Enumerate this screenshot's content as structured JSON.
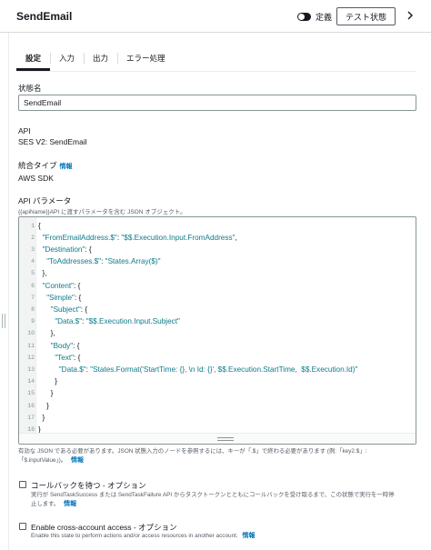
{
  "header": {
    "title": "SendEmail",
    "toggle_label": "定義",
    "test_button": "テスト状態"
  },
  "tabs": [
    {
      "label": "設定",
      "active": true
    },
    {
      "label": "入力",
      "active": false
    },
    {
      "label": "出力",
      "active": false
    },
    {
      "label": "エラー処理",
      "active": false
    }
  ],
  "state_name": {
    "label": "状態名",
    "value": "SendEmail"
  },
  "api": {
    "label": "API",
    "value": "SES V2: SendEmail"
  },
  "integration": {
    "label": "統合タイプ",
    "info": "情報",
    "value": "AWS SDK"
  },
  "api_params": {
    "label": "API パラメータ",
    "description": "{{apiName}}API に渡すパラメータを含む JSON オブジェクト。",
    "code_lines": [
      "{",
      "  \"FromEmailAddress.$\": \"$$.Execution.Input.FromAddress\",",
      "  \"Destination\": {",
      "    \"ToAddresses.$\": \"States.Array($)\"",
      "  },",
      "  \"Content\": {",
      "    \"Simple\": {",
      "      \"Subject\": {",
      "        \"Data.$\": \"$$.Execution.Input.Subject\"",
      "      },",
      "      \"Body\": {",
      "        \"Text\": {",
      "          \"Data.$\": \"States.Format('StartTime: {}, \\n Id: {}', $$.Execution.StartTime,  $$.Execution.Id)\"",
      "        }",
      "      }",
      "    }",
      "  }",
      "}"
    ],
    "help_line1": "有効な JSON である必要があります。JSON 状態入力のノードを参照するには、キーが「.$」で終わる必要があります (例:「key2.$」:",
    "help_line2": "「$.inputValue」)。",
    "help_info": "情報"
  },
  "callback": {
    "title": "コールバックを待つ",
    "suffix": " - オプション",
    "description_line1": "実行が SendTaskSuccess または SendTaskFailure API からタスクトークンとともにコールバックを受け取るまで、この状態で実行を一時停",
    "description_line2": "止します。",
    "info": "情報",
    "checked": false
  },
  "cross_account": {
    "title": "Enable cross-account access",
    "suffix": " - オプション",
    "description": "Enable this state to perform actions and/or access resources in another account.",
    "info": "情報",
    "checked": false
  }
}
